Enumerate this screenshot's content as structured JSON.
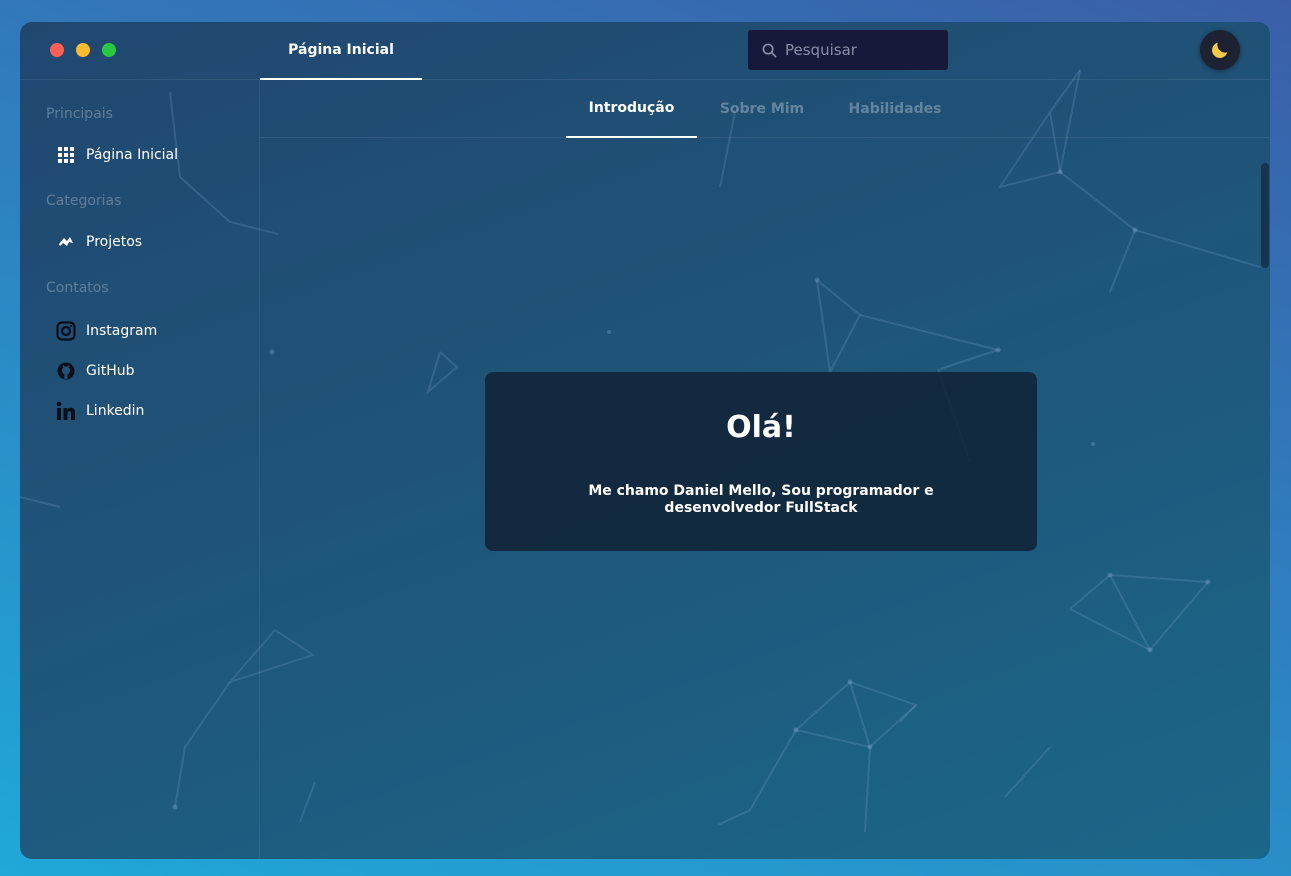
{
  "window": {
    "controls": [
      "close",
      "minimize",
      "maximize"
    ]
  },
  "header": {
    "active_tab": "Página Inicial",
    "search": {
      "placeholder": "Pesquisar",
      "value": ""
    },
    "theme_toggle_icon": "moon-icon"
  },
  "sidebar": {
    "sections": [
      {
        "title": "Principais",
        "items": [
          {
            "label": "Página Inicial",
            "icon": "grid-icon"
          }
        ]
      },
      {
        "title": "Categorias",
        "items": [
          {
            "label": "Projetos",
            "icon": "projects-icon"
          }
        ]
      },
      {
        "title": "Contatos",
        "items": [
          {
            "label": "Instagram",
            "icon": "instagram-icon"
          },
          {
            "label": "GitHub",
            "icon": "github-icon"
          },
          {
            "label": "Linkedin",
            "icon": "linkedin-icon"
          }
        ]
      }
    ]
  },
  "content": {
    "tabs": [
      {
        "label": "Introdução",
        "active": true
      },
      {
        "label": "Sobre Mim",
        "active": false
      },
      {
        "label": "Habilidades",
        "active": false
      }
    ],
    "card": {
      "heading": "Olá!",
      "text": "Me chamo Daniel Mello, Sou programador e desenvolvedor FullStack"
    }
  },
  "colors": {
    "accent_moon": "#f7c948",
    "search_bg": "#17193a",
    "card_bg": "#11233a"
  }
}
